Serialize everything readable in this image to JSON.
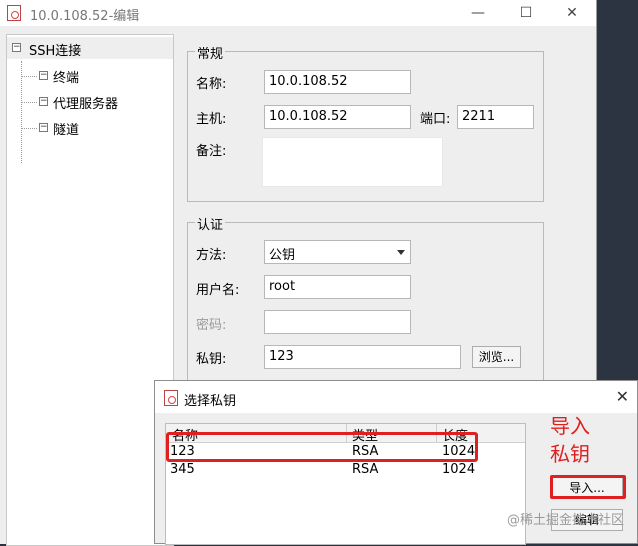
{
  "window": {
    "title": "10.0.108.52-编辑",
    "minimize": "—",
    "maximize": "☐",
    "close": "✕"
  },
  "tree": {
    "root": "SSH连接",
    "items": [
      {
        "label": "终端"
      },
      {
        "label": "代理服务器"
      },
      {
        "label": "隧道"
      }
    ]
  },
  "general": {
    "title": "常规",
    "name_label": "名称:",
    "name_value": "10.0.108.52",
    "host_label": "主机:",
    "host_value": "10.0.108.52",
    "port_label": "端口:",
    "port_value": "2211",
    "note_label": "备注:",
    "note_value": ""
  },
  "auth": {
    "title": "认证",
    "method_label": "方法:",
    "method_value": "公钥",
    "user_label": "用户名:",
    "user_value": "root",
    "password_label": "密码:",
    "password_value": "",
    "key_label": "私钥:",
    "key_value": "123",
    "browse_label": "浏览..."
  },
  "dialog": {
    "title": "选择私钥",
    "close": "✕",
    "columns": [
      "名称",
      "类型",
      "长度"
    ],
    "rows": [
      {
        "name": "123",
        "type": "RSA",
        "length": "1024"
      },
      {
        "name": "345",
        "type": "RSA",
        "length": "1024"
      }
    ],
    "import_label": "导入...",
    "edit_label": "编辑"
  },
  "annotation": {
    "line1": "导入",
    "line2": "私钥",
    "color": "#e02020"
  },
  "watermark": "@稀土掘金技术社区"
}
